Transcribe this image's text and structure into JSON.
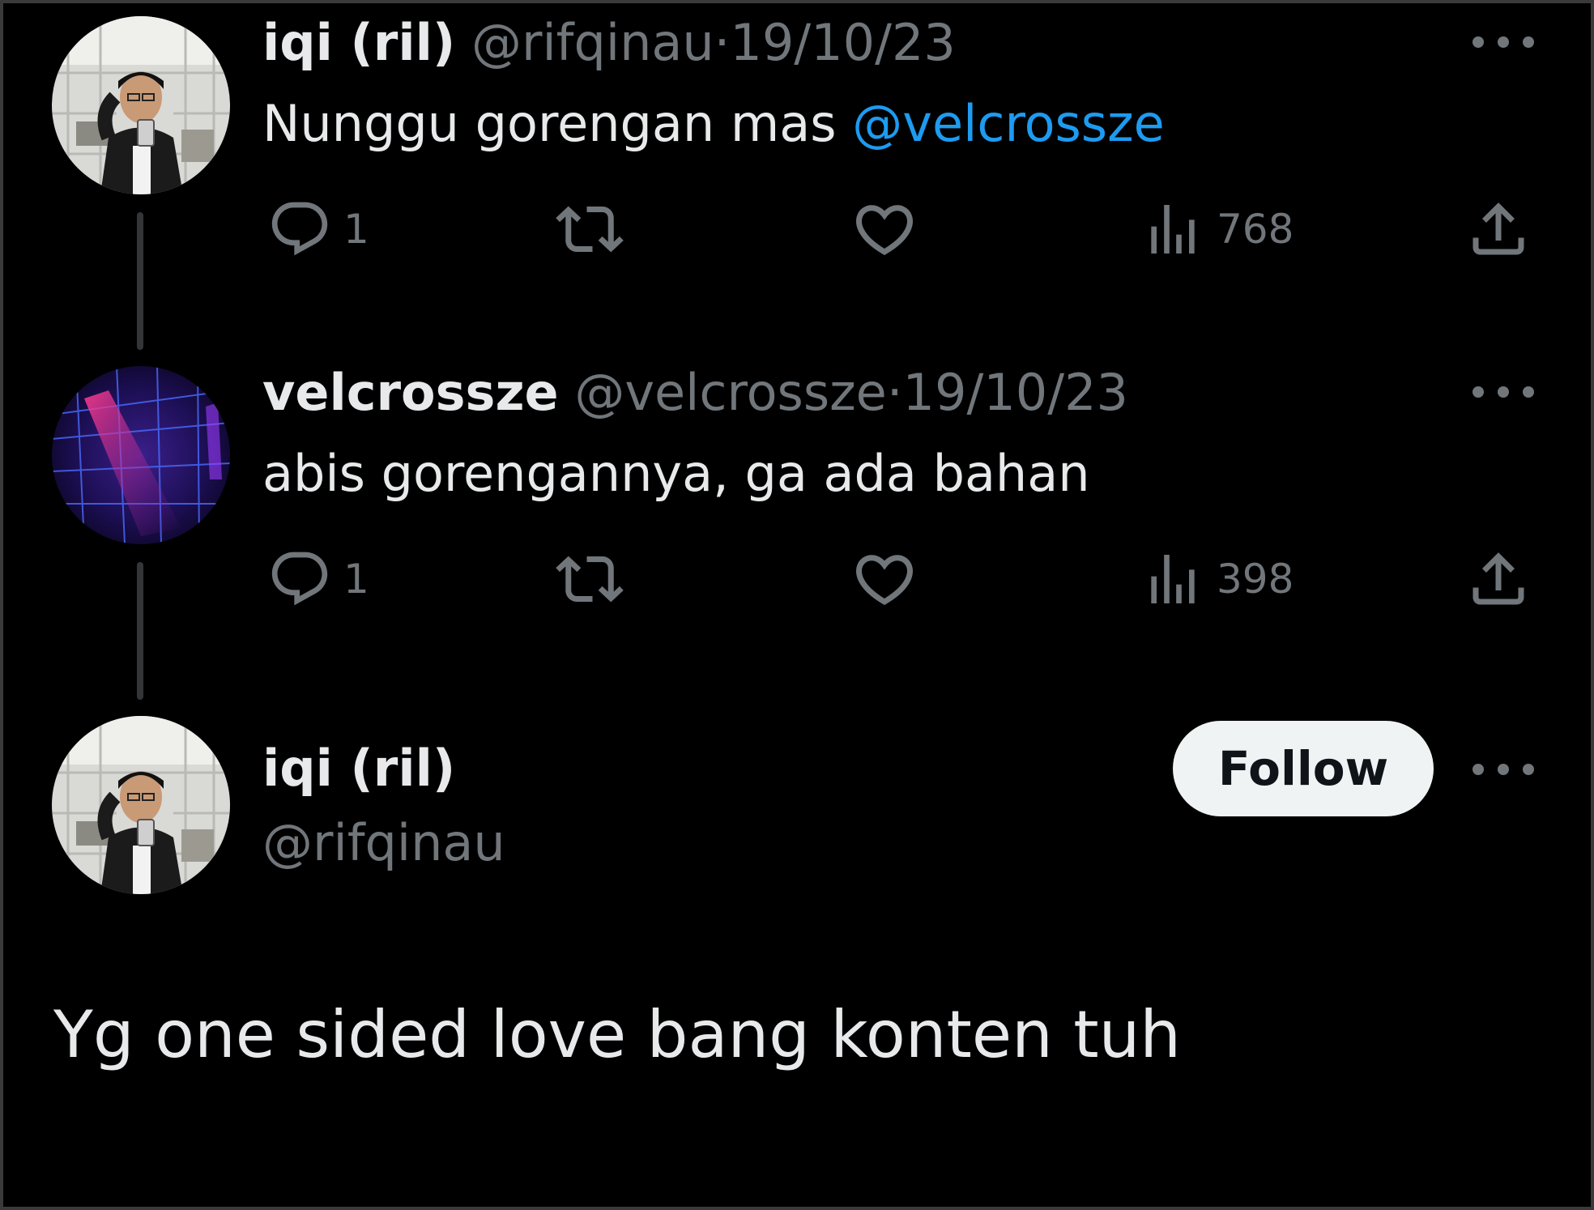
{
  "tweets": [
    {
      "name": "iqi (ril)",
      "handle": "@rifqinau",
      "separator": "·",
      "date": "19/10/23",
      "text": "Nunggu gorengan mas ",
      "mention": "@velcrossze",
      "replies": "1",
      "views": "768",
      "avatar_icon": "user-photo-avatar"
    },
    {
      "name": "velcrossze",
      "handle": "@velcrossze",
      "separator": "·",
      "date": "19/10/23",
      "text": "abis gorengannya, ga ada bahan",
      "replies": "1",
      "views": "398",
      "avatar_icon": "neon-lights-avatar"
    }
  ],
  "focused": {
    "name": "iqi (ril)",
    "handle": "@rifqinau",
    "follow_label": "Follow",
    "text": "Yg one sided love bang konten tuh"
  },
  "icons": {
    "reply": "reply-icon",
    "retweet": "retweet-icon",
    "like": "like-icon",
    "views": "views-icon",
    "share": "share-icon",
    "more": "more-icon"
  },
  "colors": {
    "background": "#000000",
    "text": "#e7e9ea",
    "muted": "#71767b",
    "mention": "#1d9bf0",
    "follow_bg": "#eff3f4"
  }
}
